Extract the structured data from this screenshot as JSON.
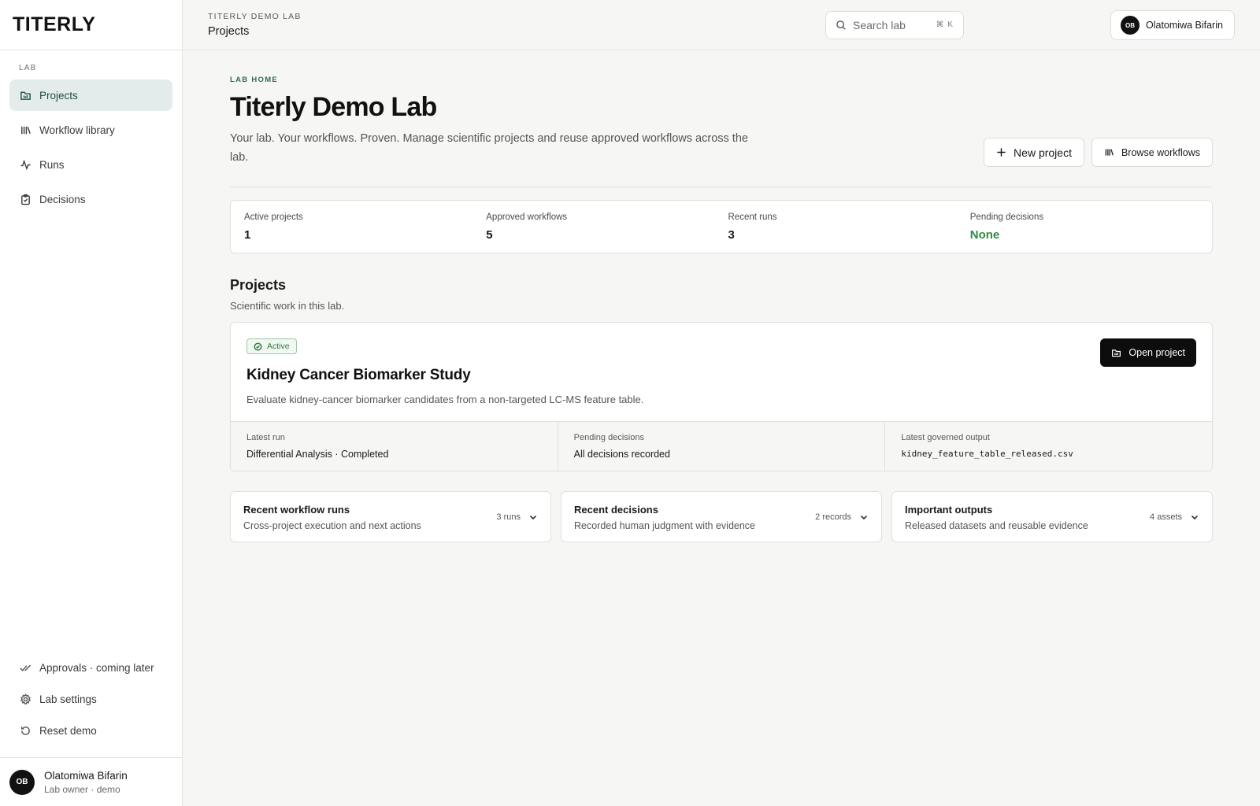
{
  "brand": {
    "name": "TITERLY"
  },
  "sidebar": {
    "section_label": "LAB",
    "items": [
      {
        "label": "Projects",
        "icon": "folder-icon",
        "active": true
      },
      {
        "label": "Workflow library",
        "icon": "library-icon"
      },
      {
        "label": "Runs",
        "icon": "activity-icon"
      },
      {
        "label": "Decisions",
        "icon": "clipboard-check-icon"
      }
    ],
    "bottom_items": [
      {
        "label": "Approvals · coming later",
        "icon": "double-check-icon"
      },
      {
        "label": "Lab settings",
        "icon": "gear-icon"
      },
      {
        "label": "Reset demo",
        "icon": "reset-icon"
      }
    ],
    "user": {
      "initials": "OB",
      "name": "Olatomiwa Bifarin",
      "role": "Lab owner · demo"
    }
  },
  "topbar": {
    "crumb_small": "TITERLY DEMO LAB",
    "crumb_title": "Projects",
    "search_placeholder": "Search lab",
    "search_shortcut": "⌘ K",
    "user_initials": "OB",
    "user_name": "Olatomiwa Bifarin"
  },
  "header": {
    "eyebrow": "LAB HOME",
    "title": "Titerly Demo Lab",
    "subtitle": "Your lab. Your workflows. Proven. Manage scientific projects and reuse approved workflows across the lab.",
    "new_project_label": "New project",
    "browse_workflows_label": "Browse workflows"
  },
  "stats": [
    {
      "label": "Active projects",
      "value": "1"
    },
    {
      "label": "Approved workflows",
      "value": "5"
    },
    {
      "label": "Recent runs",
      "value": "3"
    },
    {
      "label": "Pending decisions",
      "value": "None",
      "color": "#2e8b3e"
    }
  ],
  "projects": {
    "title": "Projects",
    "subtitle": "Scientific work in this lab.",
    "card": {
      "status": "Active",
      "name": "Kidney Cancer Biomarker Study",
      "description": "Evaluate kidney-cancer biomarker candidates from a non-targeted LC-MS feature table.",
      "open_label": "Open project",
      "meta": [
        {
          "label": "Latest run",
          "value": "Differential Analysis · Completed"
        },
        {
          "label": "Pending decisions",
          "value": "All decisions recorded"
        },
        {
          "label": "Latest governed output",
          "value": "kidney_feature_table_released.csv"
        }
      ]
    }
  },
  "panels": [
    {
      "title": "Recent workflow runs",
      "subtitle": "Cross-project execution and next actions",
      "count": "3 runs"
    },
    {
      "title": "Recent decisions",
      "subtitle": "Recorded human judgment with evidence",
      "count": "2 records"
    },
    {
      "title": "Important outputs",
      "subtitle": "Released datasets and reusable evidence",
      "count": "4 assets"
    }
  ],
  "colors": {
    "accent": "#2f6a5e",
    "active_nav_bg": "#e3ecea",
    "success": "#2e8b3e",
    "primary_button": "#0d0d0d"
  }
}
